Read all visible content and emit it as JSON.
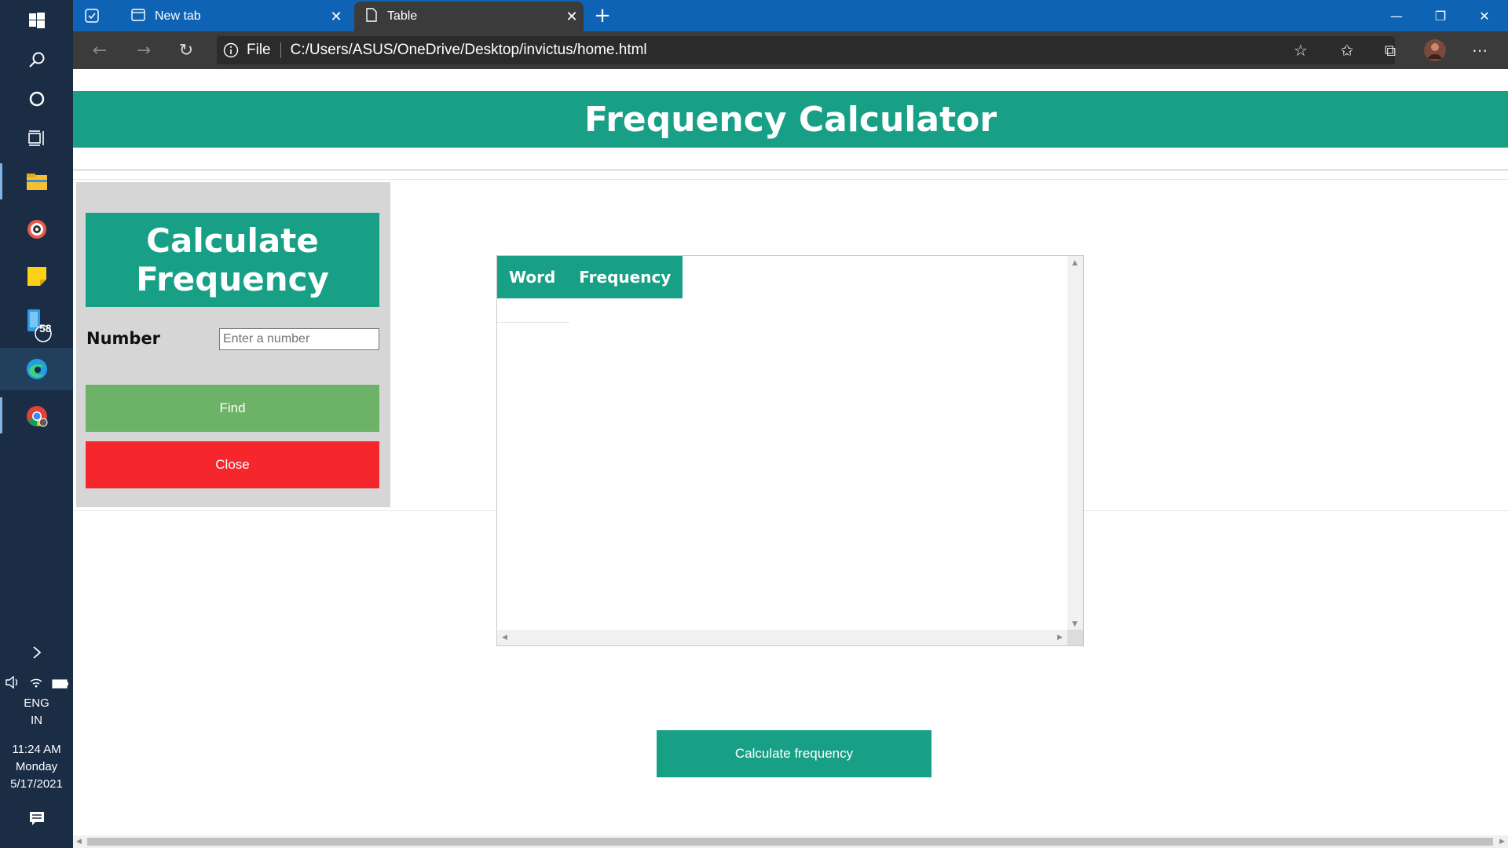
{
  "taskbar": {
    "pinned": [
      "windows-start-icon",
      "search-icon",
      "cortana-icon",
      "task-view-icon",
      "file-explorer-icon",
      "media-player-icon",
      "sticky-notes-icon",
      "phone-app-icon",
      "edge-icon",
      "chrome-icon"
    ],
    "phone_badge": "58",
    "language": "ENG",
    "region": "IN",
    "time": "11:24 AM",
    "day": "Monday",
    "date": "5/17/2021"
  },
  "browser": {
    "tabs": [
      {
        "title": "New tab",
        "active": false
      },
      {
        "title": "Table",
        "active": true
      }
    ],
    "address_scheme": "File",
    "address_url": "C:/Users/ASUS/OneDrive/Desktop/invictus/home.html",
    "colors": {
      "tabstrip": "#0f63b5",
      "toolbar": "#3b3b3b"
    }
  },
  "page": {
    "title": "Frequency Calculator",
    "panel_title": "Calculate Frequency",
    "number_label": "Number",
    "number_placeholder": "Enter a number",
    "number_value": "",
    "find_label": "Find",
    "close_label": "Close",
    "table_headers": [
      "Word",
      "Frequency"
    ],
    "table_rows": [],
    "calc_button_label": "Calculate frequency",
    "colors": {
      "accent": "#17a085",
      "find": "#6db367",
      "close": "#f6272c",
      "panel": "#d6d6d6"
    }
  }
}
